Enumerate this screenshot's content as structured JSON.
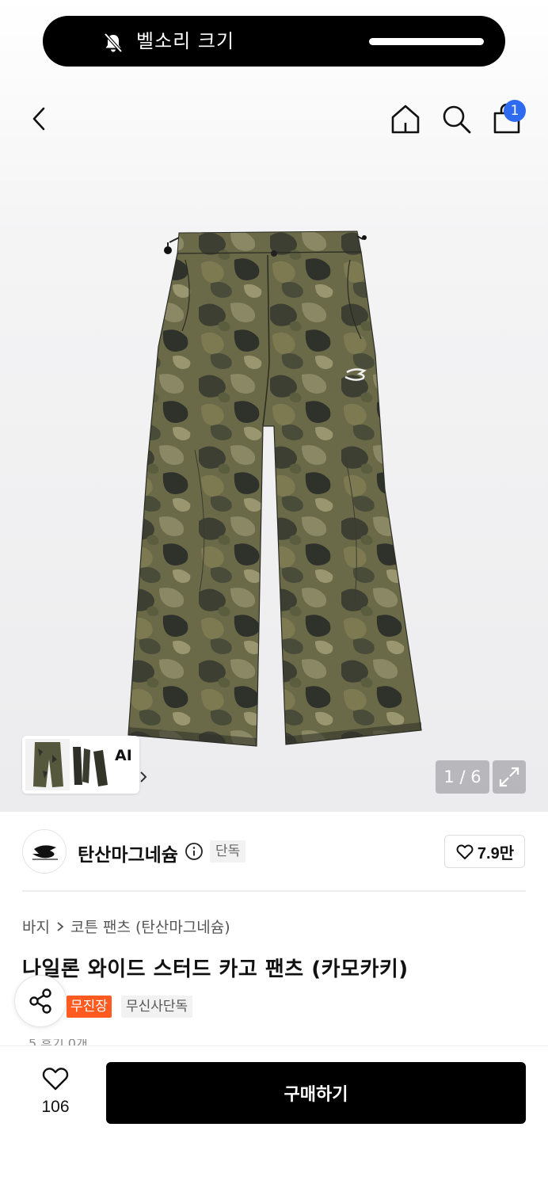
{
  "notification": {
    "label": "벨소리 크기"
  },
  "header": {
    "cart_count": "1"
  },
  "gallery": {
    "ai_label": "AI",
    "page_counter": "1 / 6"
  },
  "brand": {
    "name": "탄산마그네슘",
    "exclusive_chip": "단독",
    "likes": "7.9만"
  },
  "breadcrumb": {
    "category": "바지",
    "subcategory": "코튼 팬츠 (탄산마그네슘)"
  },
  "product": {
    "title": "나일론 와이드 스터드 카고 팬츠 (카모카키)",
    "badges": [
      "무진장",
      "무신사단독"
    ],
    "review_peek": "5 후기 0개"
  },
  "bottom_bar": {
    "wish_count": "106",
    "buy_label": "구매하기"
  },
  "colors": {
    "accent_blue": "#2f6bf0",
    "badge_orange": "#ff5a1f"
  }
}
